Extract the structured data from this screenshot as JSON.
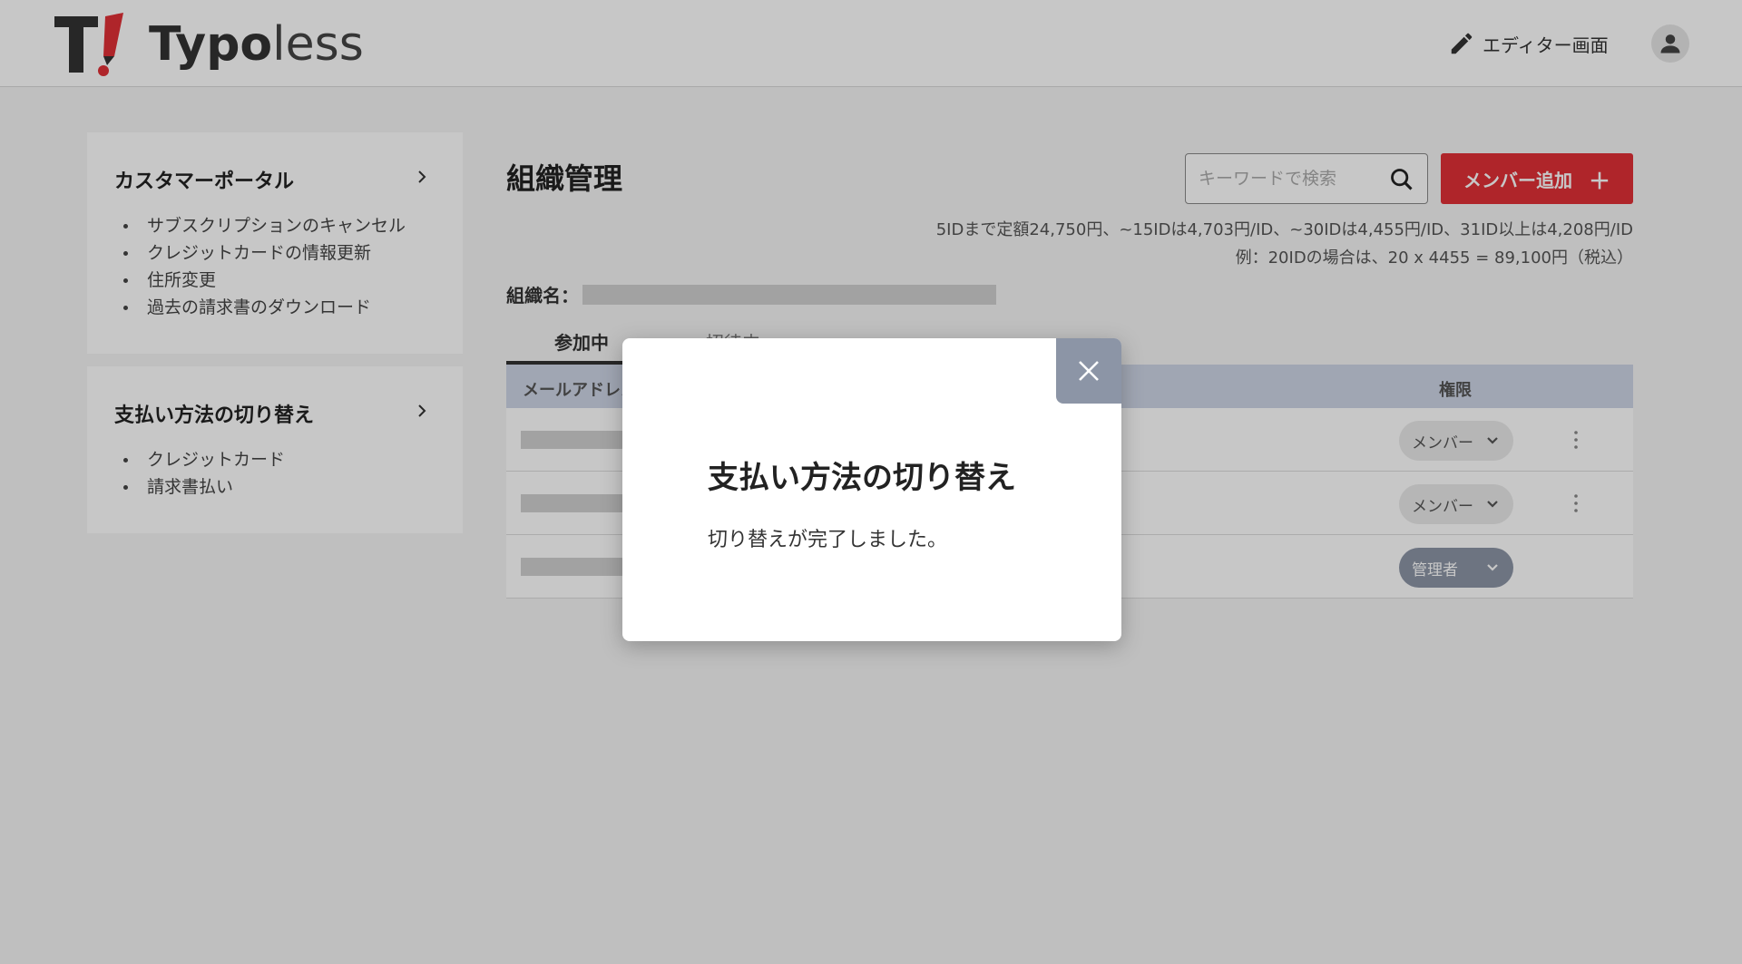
{
  "header": {
    "logo_text_bold": "Typo",
    "logo_text_rest": "less",
    "editor_label": "エディター画面"
  },
  "sidebar": {
    "cards": [
      {
        "title": "カスタマーポータル",
        "items": [
          "サブスクリプションのキャンセル",
          "クレジットカードの情報更新",
          "住所変更",
          "過去の請求書のダウンロード"
        ]
      },
      {
        "title": "支払い方法の切り替え",
        "items": [
          "クレジットカード",
          "請求書払い"
        ]
      }
    ]
  },
  "main": {
    "title": "組織管理",
    "search_placeholder": "キーワードで検索",
    "add_member_label": "メンバー追加",
    "add_member_plus": "＋",
    "price_line_1": "5IDまで定額24,750円、~15IDは4,703円/ID、~30IDは4,455円/ID、31ID以上は4,208円/ID",
    "price_line_2": "例：20IDの場合は、20 x 4455 = 89,100円（税込）",
    "org_label": "組織名：",
    "tabs": [
      {
        "label": "参加中"
      },
      {
        "label": "招待中"
      }
    ],
    "table": {
      "headers": {
        "email": "メールアドレス",
        "role": "権限"
      },
      "rows": [
        {
          "role": "メンバー"
        },
        {
          "role": "メンバー"
        },
        {
          "role": "管理者"
        }
      ]
    }
  },
  "modal": {
    "title": "支払い方法の切り替え",
    "message": "切り替えが完了しました。"
  },
  "colors": {
    "brand_red": "#e03037",
    "table_header": "#cdd5e6",
    "close_button": "#8c95a6"
  }
}
